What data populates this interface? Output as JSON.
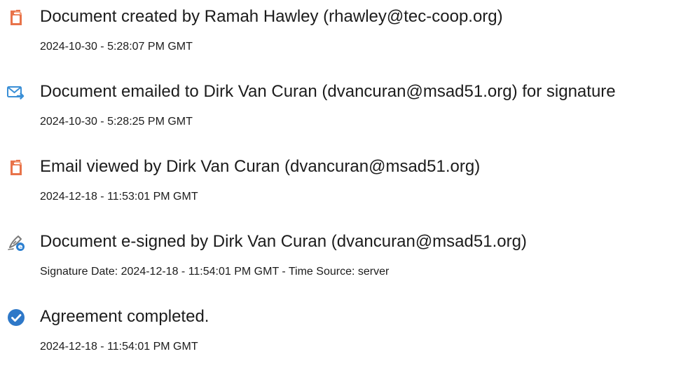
{
  "events": [
    {
      "icon": "document-icon",
      "title": "Document created by Ramah Hawley (rhawley@tec-coop.org)",
      "meta": "2024-10-30 - 5:28:07 PM GMT"
    },
    {
      "icon": "email-sent-icon",
      "title": "Document emailed to Dirk Van Curan (dvancuran@msad51.org) for signature",
      "meta": "2024-10-30 - 5:28:25 PM GMT"
    },
    {
      "icon": "document-icon",
      "title": "Email viewed by Dirk Van Curan (dvancuran@msad51.org)",
      "meta": "2024-12-18 - 11:53:01 PM GMT"
    },
    {
      "icon": "esign-pen-icon",
      "title": "Document e-signed by Dirk Van Curan (dvancuran@msad51.org)",
      "meta": "Signature Date: 2024-12-18 - 11:54:01 PM GMT - Time Source: server"
    },
    {
      "icon": "checkmark-circle-icon",
      "title": "Agreement completed.",
      "meta": "2024-12-18 - 11:54:01 PM GMT"
    }
  ],
  "colors": {
    "document_icon": "#e8734a",
    "email_icon": "#3a8fd6",
    "esign_icon": "#7a7a7a",
    "esign_badge": "#2b7fd0",
    "check_icon": "#2e78c8",
    "text": "#1c1c1c"
  }
}
